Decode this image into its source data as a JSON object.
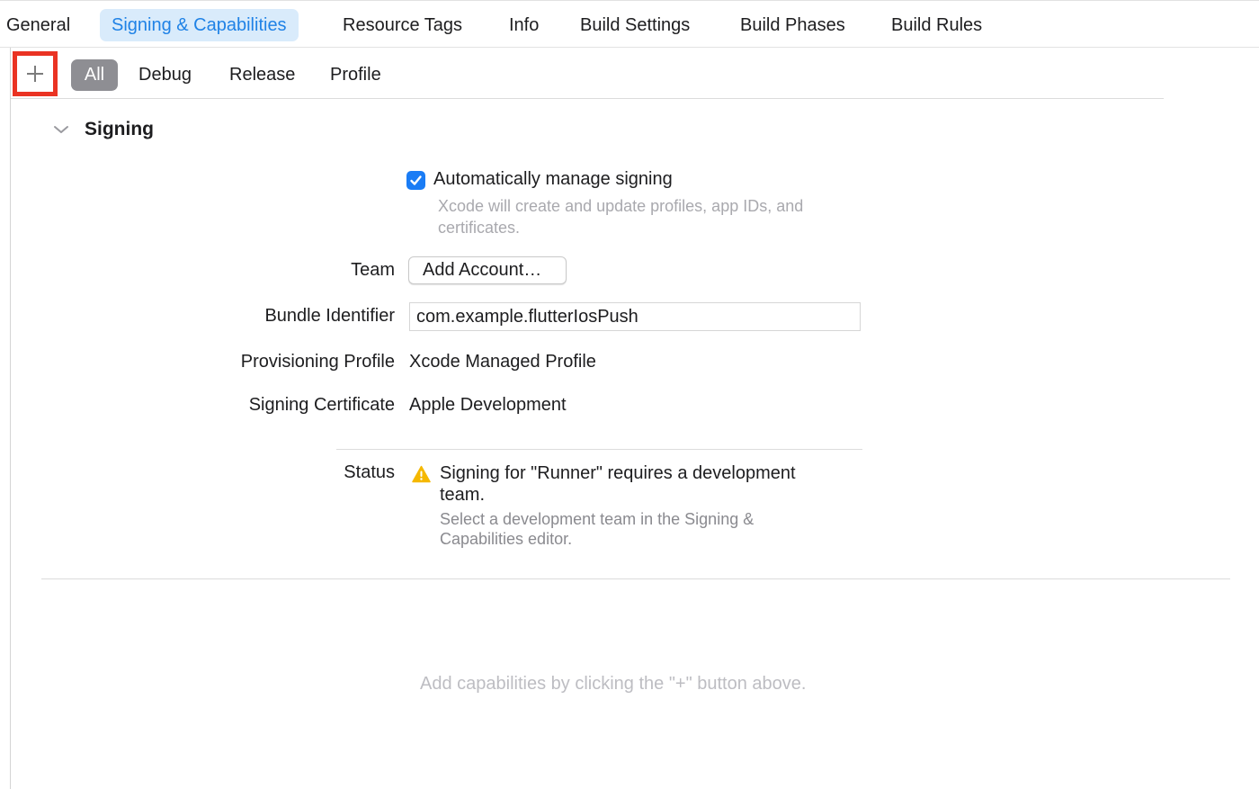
{
  "tabs": [
    {
      "label": "General"
    },
    {
      "label": "Signing & Capabilities",
      "selected": true
    },
    {
      "label": "Resource Tags"
    },
    {
      "label": "Info"
    },
    {
      "label": "Build Settings"
    },
    {
      "label": "Build Phases"
    },
    {
      "label": "Build Rules"
    }
  ],
  "toolbar": {
    "add_capability_icon": "plus-icon",
    "highlight_color": "#ea3323",
    "filters": [
      {
        "label": "All",
        "selected": true
      },
      {
        "label": "Debug"
      },
      {
        "label": "Release"
      },
      {
        "label": "Profile"
      }
    ]
  },
  "signing": {
    "title": "Signing",
    "auto_manage_label": "Automatically manage signing",
    "auto_manage_checked": true,
    "auto_manage_hint_1": "Xcode will create and update profiles, app IDs, and",
    "auto_manage_hint_2": "certificates.",
    "team_label": "Team",
    "team_button": "Add Account…",
    "bundle_label": "Bundle Identifier",
    "bundle_value": "com.example.flutterIosPush",
    "profile_label": "Provisioning Profile",
    "profile_value": "Xcode Managed Profile",
    "certificate_label": "Signing Certificate",
    "certificate_value": "Apple Development",
    "status_label": "Status",
    "status_icon": "warning-icon",
    "status_message_1": "Signing for \"Runner\" requires a development",
    "status_message_2": "team.",
    "status_detail_1": "Select a development team in the Signing &",
    "status_detail_2": "Capabilities editor."
  },
  "capabilities_hint": "Add capabilities by clicking the \"+\" button above.",
  "colors": {
    "accent": "#1f82e6",
    "tab_selected_bg": "#d9ebfb",
    "checkbox": "#1a7cf5",
    "warning": "#f5b800"
  }
}
